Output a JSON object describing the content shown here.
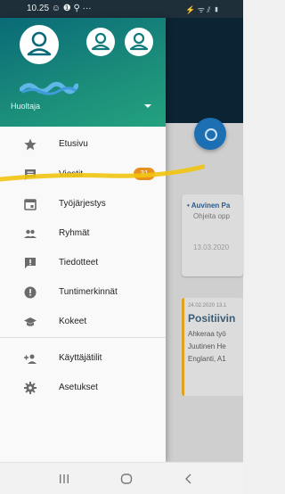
{
  "status_bar": {
    "time": "10.25 ☺ ❶ ⚲ ···",
    "right": "⚡ ᯤ ⫽ ▮"
  },
  "drawer": {
    "account_label": "Huoltaja",
    "menu": [
      {
        "label": "Etusivu",
        "icon": "star-icon"
      },
      {
        "label": "Viestit",
        "icon": "message-icon",
        "badge": "31"
      },
      {
        "label": "Työjärjestys",
        "icon": "calendar-icon"
      },
      {
        "label": "Ryhmät",
        "icon": "group-icon"
      },
      {
        "label": "Tiedotteet",
        "icon": "announcement-icon"
      },
      {
        "label": "Tuntimerkinnät",
        "icon": "alert-icon"
      },
      {
        "label": "Kokeet",
        "icon": "graduation-cap-icon"
      },
      {
        "label": "Käyttäjätilit",
        "icon": "add-person-icon"
      },
      {
        "label": "Asetukset",
        "icon": "gear-icon"
      }
    ]
  },
  "background": {
    "card1": {
      "line1": "• Auvinen Pa",
      "line2": "Ohjeita opp",
      "date": "13.03.2020"
    },
    "card2": {
      "date": "24.02.2020 13.1",
      "title": "Positiivin",
      "line1": "Ahkeraa työ",
      "line2": "Juutinen He",
      "line3": "Englanti, A1"
    }
  },
  "colors": {
    "header_start": "#0a6a78",
    "header_end": "#23a27f",
    "badge": "#e8901e",
    "fab": "#1b6fb2"
  }
}
